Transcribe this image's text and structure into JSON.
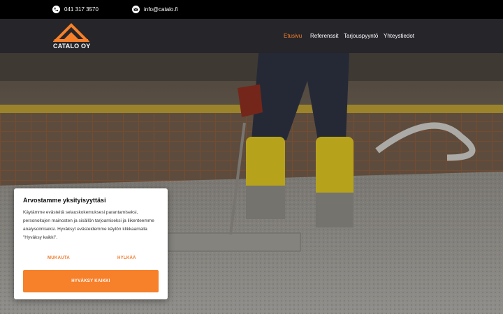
{
  "topbar": {
    "phone": "041 317 3570",
    "email": "info@catalo.fi",
    "phone_icon": "phone-icon",
    "email_icon": "envelope-icon"
  },
  "header": {
    "logo_text": "CATALO OY",
    "nav": [
      {
        "label": "Etusivu",
        "active": true
      },
      {
        "label": "Referenssit",
        "active": false
      },
      {
        "label": "Tarjouspyyntö",
        "active": false
      },
      {
        "label": "Yhteystiedot",
        "active": false
      }
    ]
  },
  "cookie": {
    "title": "Arvostamme yksityisyyttäsi",
    "text": "Käytämme evästeitä selauskokemuksesi parantamiseksi, personoitujen mainosten ja sisällön tarjoamiseksi ja liikenteemme analysoimiseksi. Hyväksyt evästeidemme käytön klikkaamalla \"Hyväksy kaikki\".",
    "customize": "MUKAUTA",
    "reject": "HYLKÄÄ",
    "accept": "HYVÄKSY KAIKKI"
  },
  "colors": {
    "accent": "#f7802a",
    "topbar": "#000000",
    "header": "#25252a"
  }
}
